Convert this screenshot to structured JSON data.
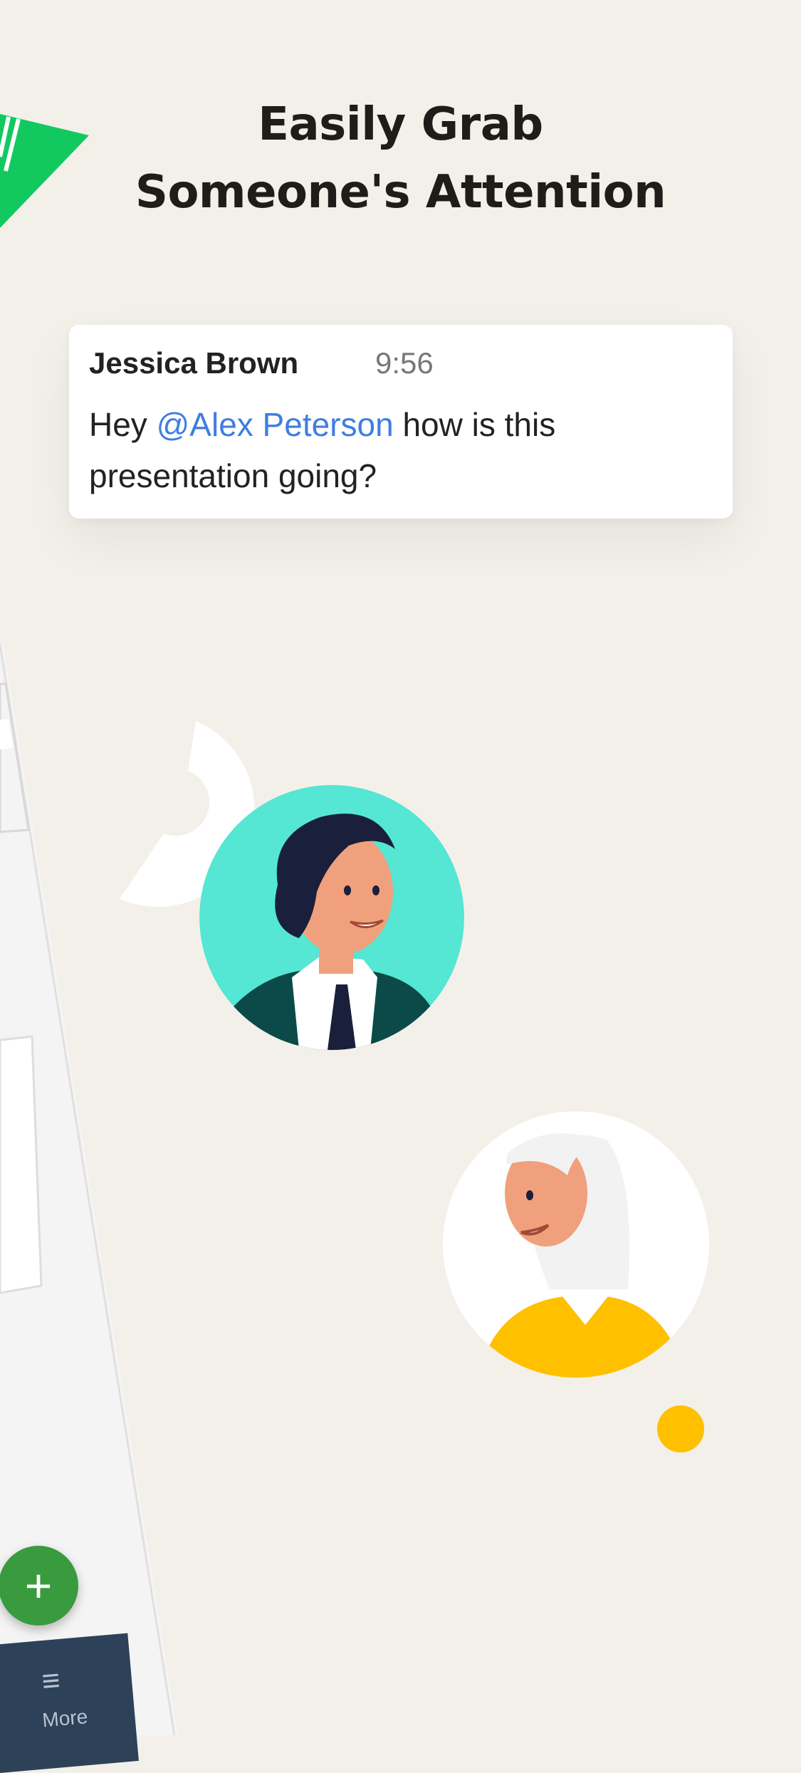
{
  "headline": {
    "line1": "Easily Grab",
    "line2": "Someone's Attention"
  },
  "message_card": {
    "sender": "Jessica Brown",
    "time": "9:56",
    "text_before": "Hey ",
    "mention": "@Alex Peterson",
    "text_after": " how is this presentation going?"
  },
  "phone": {
    "fab_label": "+",
    "bottom_nav": {
      "icon": "menu-icon",
      "label": "More"
    }
  },
  "illustrations": {
    "man_avatar_bg": "#55e6d4",
    "woman_avatar_bg": "#ffffff",
    "accent_green": "#12c95f",
    "accent_yellow": "#ffc000"
  }
}
